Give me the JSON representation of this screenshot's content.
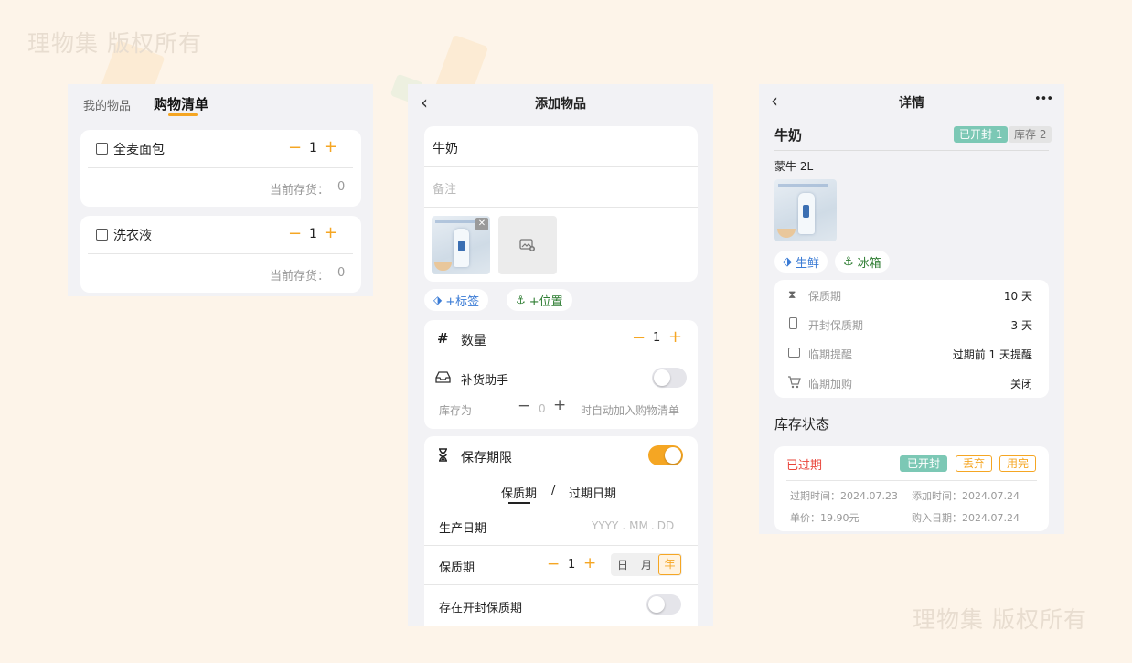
{
  "watermark": "理物集 版权所有",
  "panel1": {
    "tab_my_items": "我的物品",
    "tab_shopping_list": "购物清单",
    "items": [
      {
        "name": "全麦面包",
        "qty": "1",
        "stock_label": "当前存货：",
        "stock_value": "0"
      },
      {
        "name": "洗衣液",
        "qty": "1",
        "stock_label": "当前存货：",
        "stock_value": "0"
      }
    ]
  },
  "panel2": {
    "title": "添加物品",
    "name_value": "牛奶",
    "note_placeholder": "备注",
    "add_tag": "+标签",
    "add_location": "+位置",
    "quantity_label": "数量",
    "quantity_value": "1",
    "restock_label": "补货助手",
    "restock_on": false,
    "stock_is_label": "库存为",
    "stock_is_value": "0",
    "auto_add_text": "时自动加入购物清单",
    "shelf_life_label": "保存期限",
    "shelf_life_on": true,
    "seg_shelf": "保质期",
    "seg_sep": "/",
    "seg_expiry": "过期日期",
    "production_date_label": "生产日期",
    "date_yyyy": "YYYY",
    "date_mm": "MM",
    "date_dd": "DD",
    "date_dot": ".",
    "shelf_period_label": "保质期",
    "shelf_period_value": "1",
    "unit_day": "日",
    "unit_month": "月",
    "unit_year": "年",
    "opened_shelf_label": "存在开封保质期",
    "opened_shelf_on": false
  },
  "panel3": {
    "title": "详情",
    "more": "•••",
    "item_name": "牛奶",
    "badge_opened": "已开封 1",
    "badge_stock": "库存 2",
    "brand": "蒙牛 2L",
    "tag_fresh": "生鲜",
    "tag_fridge": "冰箱",
    "rows": [
      {
        "label": "保质期",
        "value": "10 天"
      },
      {
        "label": "开封保质期",
        "value": "3 天"
      },
      {
        "label": "临期提醒",
        "value": "过期前 1 天提醒"
      },
      {
        "label": "临期加购",
        "value": "关闭"
      }
    ],
    "stock_status_title": "库存状态",
    "status": "已过期",
    "btn_opened": "已开封",
    "btn_discard": "丢弃",
    "btn_used_up": "用完",
    "expire_time": "过期时间：2024.07.23",
    "add_time": "添加时间：2024.07.24",
    "unit_price": "单价：19.90元",
    "buy_date": "购入日期：2024.07.24"
  },
  "colors": {
    "accent": "#f5a623",
    "teal": "#7cc8b5",
    "expired": "#e9443a"
  }
}
